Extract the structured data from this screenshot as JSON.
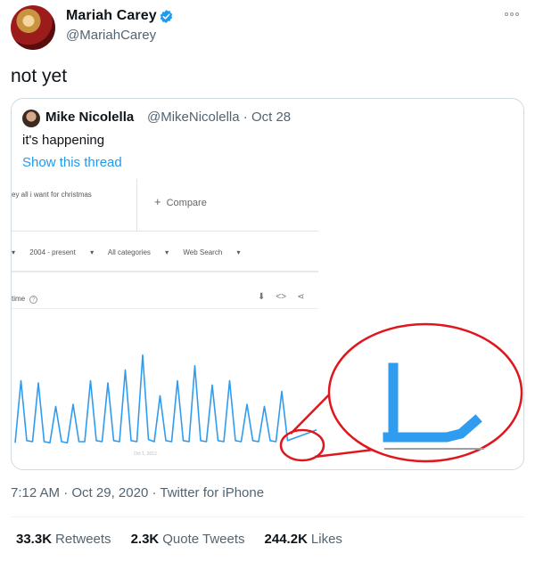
{
  "author": {
    "name": "Mariah Carey",
    "handle": "@MariahCarey",
    "verified": true
  },
  "tweet_text": "not yet",
  "quoted": {
    "name": "Mike Nicolella",
    "handle": "@MikeNicolella",
    "date": "Oct 28",
    "text": "it's happening",
    "thread_link": "Show this thread",
    "screenshot": {
      "search_term": "ey all i want for christmas",
      "compare_label": "Compare",
      "filters": [
        "2004 - present",
        "All categories",
        "Web Search"
      ],
      "panel_label": "time",
      "date_tick": "Oct 1, 2012"
    }
  },
  "meta": {
    "time": "7:12 AM",
    "date": "Oct 29, 2020",
    "client": "Twitter for iPhone"
  },
  "stats": {
    "retweets": "33.3K",
    "retweets_label": "Retweets",
    "quotes": "2.3K",
    "quotes_label": "Quote Tweets",
    "likes": "244.2K",
    "likes_label": "Likes"
  },
  "colors": {
    "accent": "#1d9bf0",
    "trend_line": "#2f9cf0",
    "annotation": "#e0161d"
  },
  "chart_data": {
    "type": "line",
    "series": [
      {
        "values": [
          4,
          62,
          6,
          5,
          60,
          5,
          4,
          38,
          5,
          4,
          40,
          5,
          5,
          62,
          6,
          5,
          60,
          6,
          5,
          72,
          6,
          5,
          86,
          7,
          5,
          48,
          6,
          5,
          62,
          6,
          5,
          76,
          6,
          5,
          58,
          6,
          5,
          62,
          6,
          5,
          40,
          6,
          5,
          38,
          6,
          5,
          52,
          6,
          8,
          10,
          12,
          14,
          16
        ]
      }
    ]
  }
}
